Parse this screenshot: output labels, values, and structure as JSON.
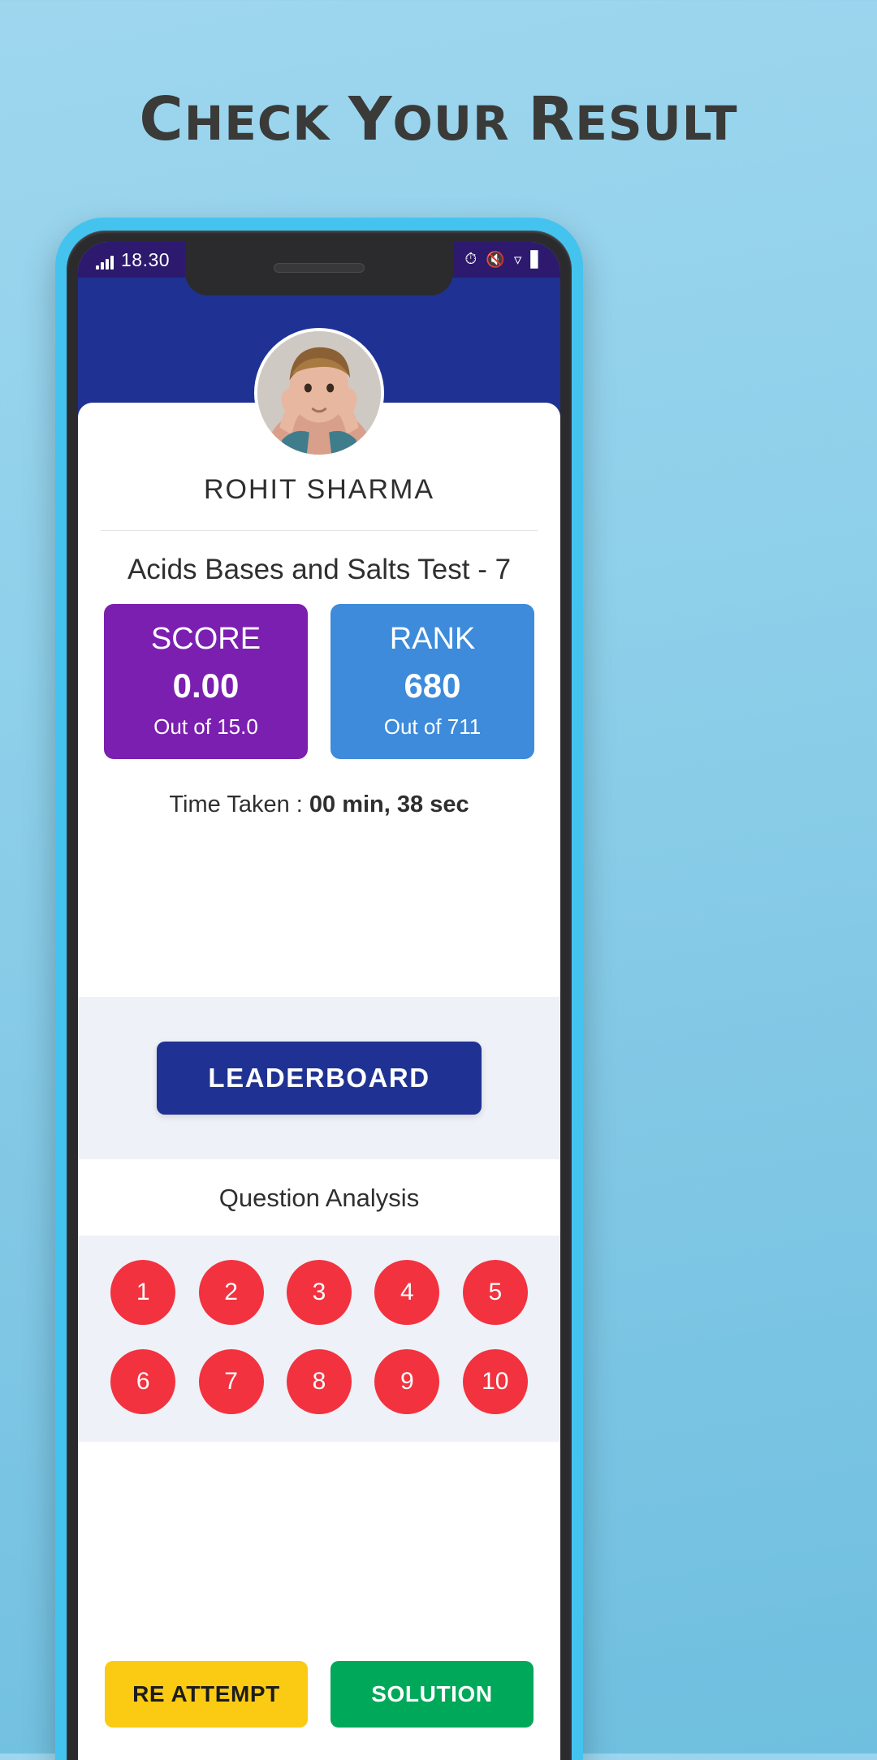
{
  "promo": {
    "headline_words": [
      "Check",
      "Your",
      "Result"
    ]
  },
  "phone": {
    "status_bar": {
      "time": "18.30",
      "signal_icon": "signal-bars-icon",
      "icons": [
        "alarm-icon",
        "mute-icon",
        "wifi-icon",
        "battery-icon"
      ]
    },
    "header": {
      "close_label": "✕",
      "help_label": "?",
      "bg_color": "#1f3293"
    },
    "result": {
      "avatar_name": "user-avatar",
      "user_name": "ROHIT SHARMA",
      "test_title": "Acids Bases and Salts Test - 7",
      "score": {
        "label": "SCORE",
        "value": "0.00",
        "sub": "Out of 15.0",
        "color": "#7b1fb0"
      },
      "rank": {
        "label": "RANK",
        "value": "680",
        "sub": "Out of 711",
        "color": "#3d8bda"
      },
      "time_taken_label": "Time Taken : ",
      "time_taken_value": "00 min, 38 sec"
    },
    "leaderboard_button": "LEADERBOARD",
    "question_analysis": {
      "title": "Question Analysis",
      "questions": [
        {
          "number": "1",
          "status": "wrong"
        },
        {
          "number": "2",
          "status": "wrong"
        },
        {
          "number": "3",
          "status": "wrong"
        },
        {
          "number": "4",
          "status": "wrong"
        },
        {
          "number": "5",
          "status": "wrong"
        },
        {
          "number": "6",
          "status": "wrong"
        },
        {
          "number": "7",
          "status": "wrong"
        },
        {
          "number": "8",
          "status": "wrong"
        },
        {
          "number": "9",
          "status": "wrong"
        },
        {
          "number": "10",
          "status": "wrong"
        }
      ],
      "wrong_color": "#f2323f"
    },
    "footer": {
      "reattempt_label": "RE ATTEMPT",
      "reattempt_color": "#fbcb13",
      "solution_label": "SOLUTION",
      "solution_color": "#00a859"
    }
  }
}
